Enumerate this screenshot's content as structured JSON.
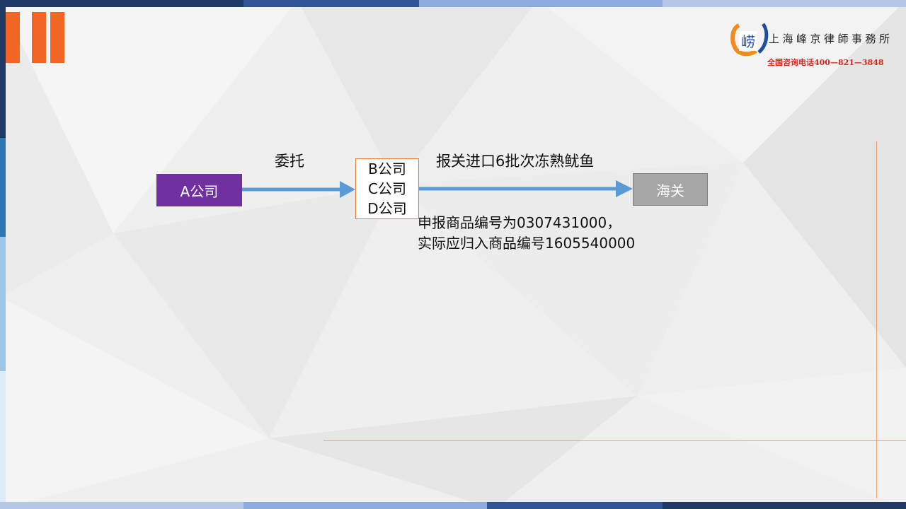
{
  "header": {
    "firm_name": "上海峰京律師事務所",
    "hotline": "全国咨询电话400—821—3848",
    "logo_glyph": "崂"
  },
  "diagram": {
    "nodes": {
      "a": "A公司",
      "bcd": [
        "B公司",
        "C公司",
        "D公司"
      ],
      "customs": "海关"
    },
    "edges": {
      "entrust_label": "委托",
      "declare_label": "报关进口6批次冻熟鱿鱼"
    },
    "note": [
      "申报商品编号为0307431000，",
      "实际应归入商品编号1605540000"
    ]
  },
  "colors": {
    "accent_orange": "#f26522",
    "node_a": "#7030a0",
    "node_customs": "#a6a6a6",
    "arrow": "#5b9bd5",
    "hotline": "#d9261c"
  }
}
